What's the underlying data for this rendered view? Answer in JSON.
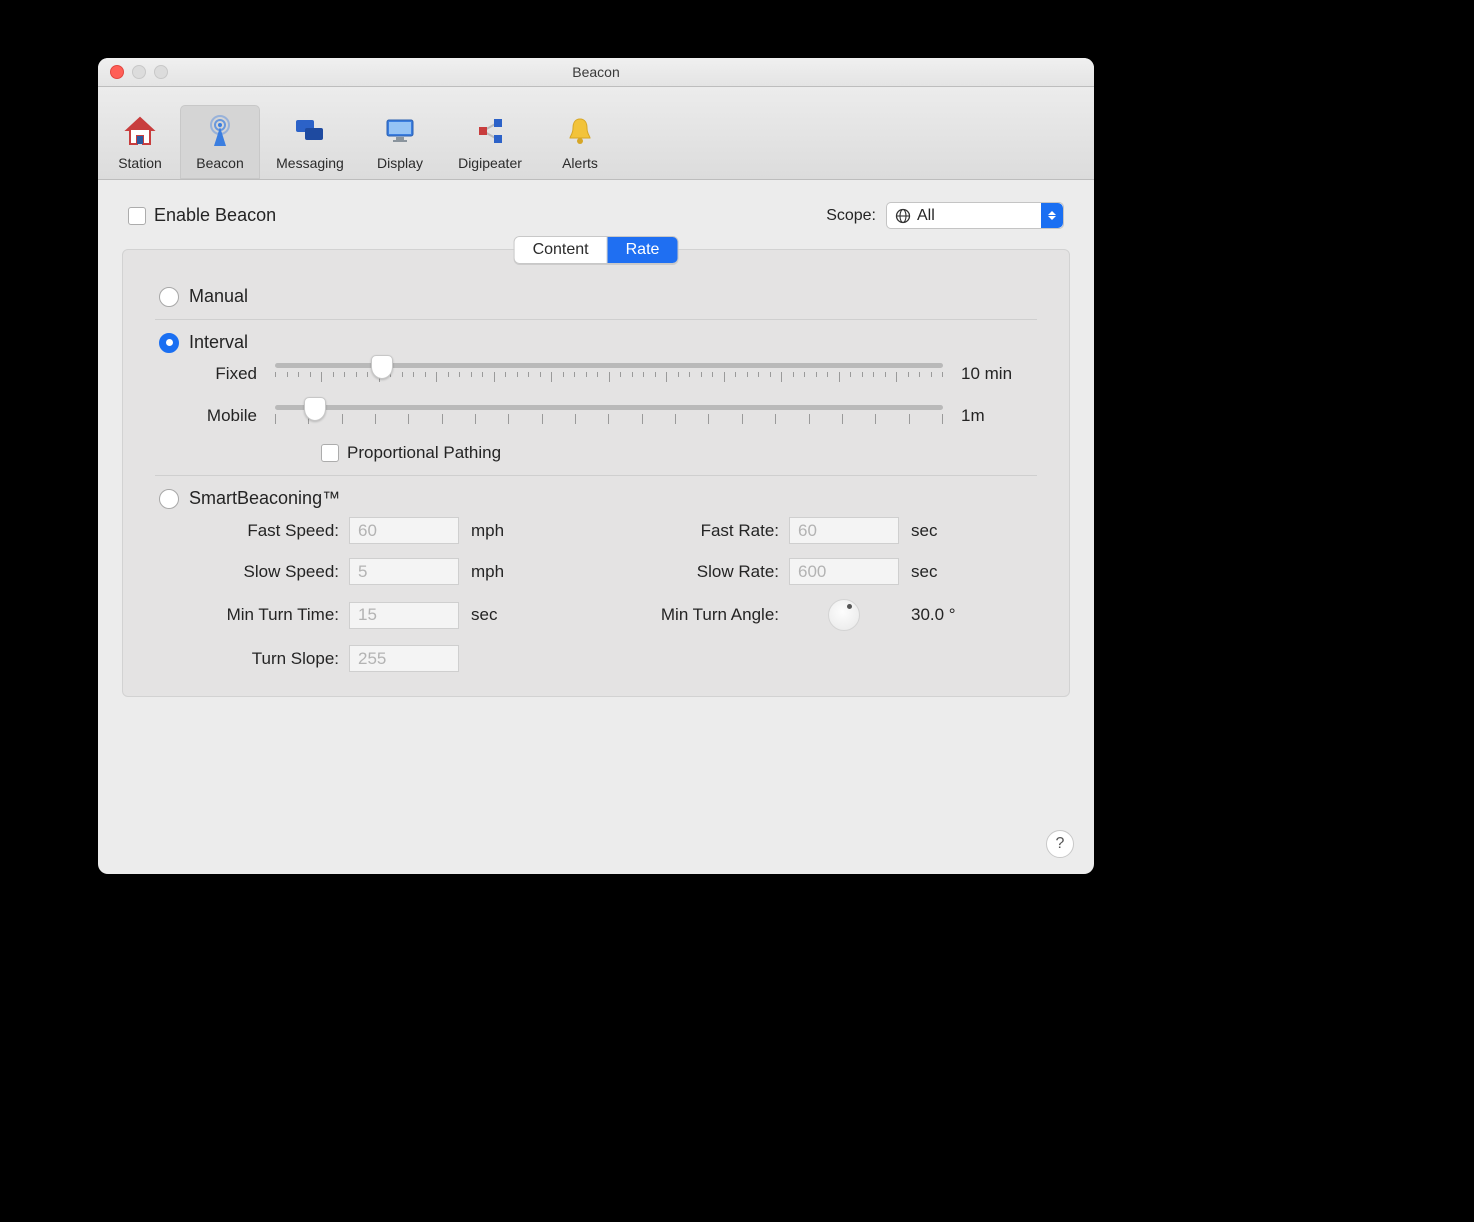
{
  "window": {
    "title": "Beacon"
  },
  "toolbar": {
    "items": [
      {
        "label": "Station"
      },
      {
        "label": "Beacon"
      },
      {
        "label": "Messaging"
      },
      {
        "label": "Display"
      },
      {
        "label": "Digipeater"
      },
      {
        "label": "Alerts"
      }
    ],
    "selected": "Beacon"
  },
  "enable": {
    "label": "Enable Beacon",
    "checked": false
  },
  "scope": {
    "label": "Scope:",
    "value": "All"
  },
  "seg": {
    "content": "Content",
    "rate": "Rate",
    "active": "Rate"
  },
  "mode": {
    "manual_label": "Manual",
    "interval_label": "Interval",
    "smart_label": "SmartBeaconing™",
    "selected": "Interval"
  },
  "interval": {
    "fixed_label": "Fixed",
    "fixed_value": "10 min",
    "fixed_pos_pct": 16,
    "mobile_label": "Mobile",
    "mobile_value": "1m",
    "mobile_pos_pct": 6,
    "proportional_label": "Proportional Pathing",
    "proportional_checked": false
  },
  "smart": {
    "fast_speed_label": "Fast Speed:",
    "fast_speed_value": "60",
    "fast_speed_unit": "mph",
    "slow_speed_label": "Slow Speed:",
    "slow_speed_value": "5",
    "slow_speed_unit": "mph",
    "min_turn_time_label": "Min Turn Time:",
    "min_turn_time_value": "15",
    "min_turn_time_unit": "sec",
    "turn_slope_label": "Turn Slope:",
    "turn_slope_value": "255",
    "fast_rate_label": "Fast Rate:",
    "fast_rate_value": "60",
    "fast_rate_unit": "sec",
    "slow_rate_label": "Slow Rate:",
    "slow_rate_value": "600",
    "slow_rate_unit": "sec",
    "min_turn_angle_label": "Min Turn Angle:",
    "min_turn_angle_value": "30.0 °"
  },
  "help_glyph": "?"
}
